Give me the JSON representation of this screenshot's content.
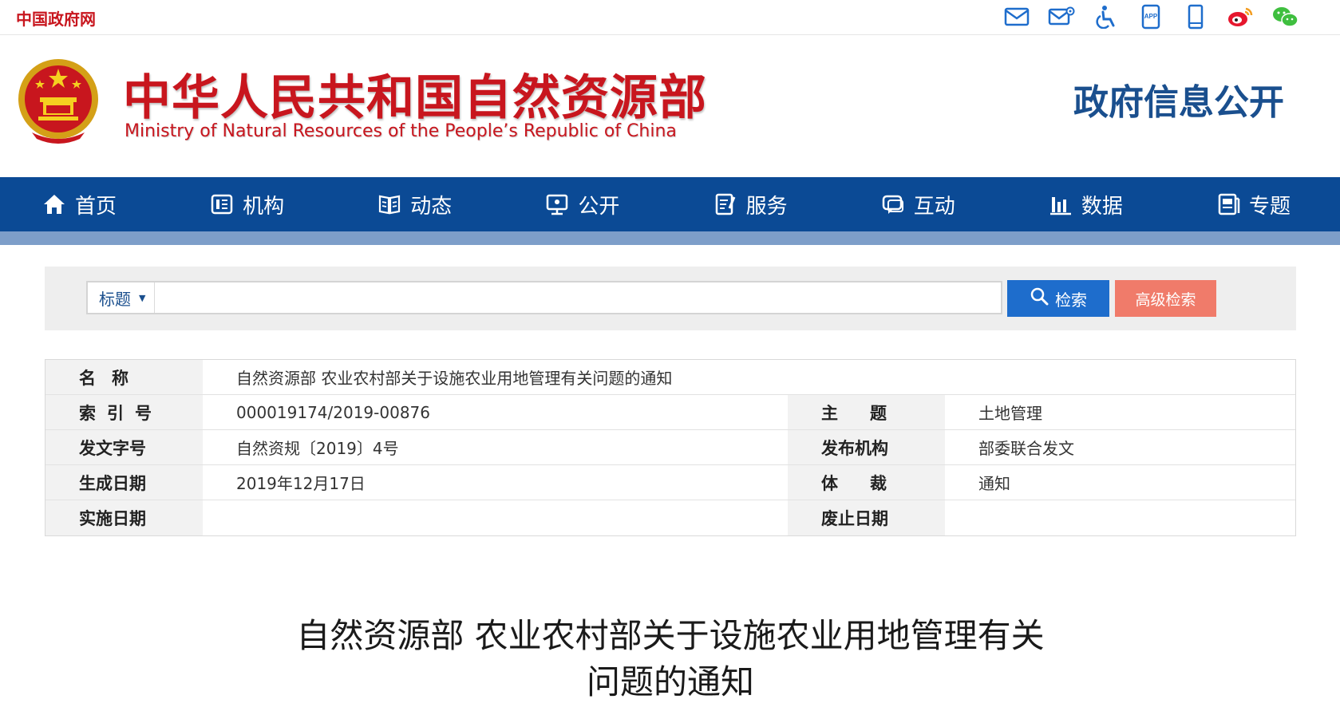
{
  "topbar": {
    "gov_link": "中国政府网",
    "icons": [
      {
        "name": "mail-icon"
      },
      {
        "name": "mail-settings-icon"
      },
      {
        "name": "accessibility-icon"
      },
      {
        "name": "app-icon",
        "label": "APP"
      },
      {
        "name": "mobile-icon"
      },
      {
        "name": "weibo-icon"
      },
      {
        "name": "wechat-icon"
      }
    ]
  },
  "header": {
    "title_cn": "中华人民共和国自然资源部",
    "title_en": "Ministry of Natural Resources of the People’s Republic of China",
    "section": "政府信息公开"
  },
  "nav": {
    "items": [
      {
        "label": "首页",
        "icon": "home-icon"
      },
      {
        "label": "机构",
        "icon": "organization-icon"
      },
      {
        "label": "动态",
        "icon": "news-icon"
      },
      {
        "label": "公开",
        "icon": "disclosure-icon"
      },
      {
        "label": "服务",
        "icon": "service-icon"
      },
      {
        "label": "互动",
        "icon": "interaction-icon"
      },
      {
        "label": "数据",
        "icon": "data-chart-icon"
      },
      {
        "label": "专题",
        "icon": "topic-icon"
      }
    ]
  },
  "search": {
    "field_select": "标题",
    "input_value": "",
    "search_button": "检索",
    "advanced_button": "高级检索"
  },
  "info": {
    "name_label": "名称",
    "name_value": "自然资源部 农业农村部关于设施农业用地管理有关问题的通知",
    "index_label": "索引号",
    "index_value": "000019174/2019-00876",
    "subject_label": "主题",
    "subject_value": "土地管理",
    "docno_label": "发文字号",
    "docno_value": "自然资规〔2019〕4号",
    "issuer_label": "发布机构",
    "issuer_value": "部委联合发文",
    "created_label": "生成日期",
    "created_value": "2019年12月17日",
    "genre_label": "体裁",
    "genre_value": "通知",
    "effective_label": "实施日期",
    "effective_value": "",
    "expiry_label": "废止日期",
    "expiry_value": ""
  },
  "document": {
    "title_line1": "自然资源部  农业农村部关于设施农业用地管理有关",
    "title_line2": "问题的通知"
  },
  "colors": {
    "brand_red": "#c8161e",
    "nav_blue": "#0b4a95",
    "search_blue": "#1e6dcc",
    "advanced_salmon": "#f07b6a"
  }
}
